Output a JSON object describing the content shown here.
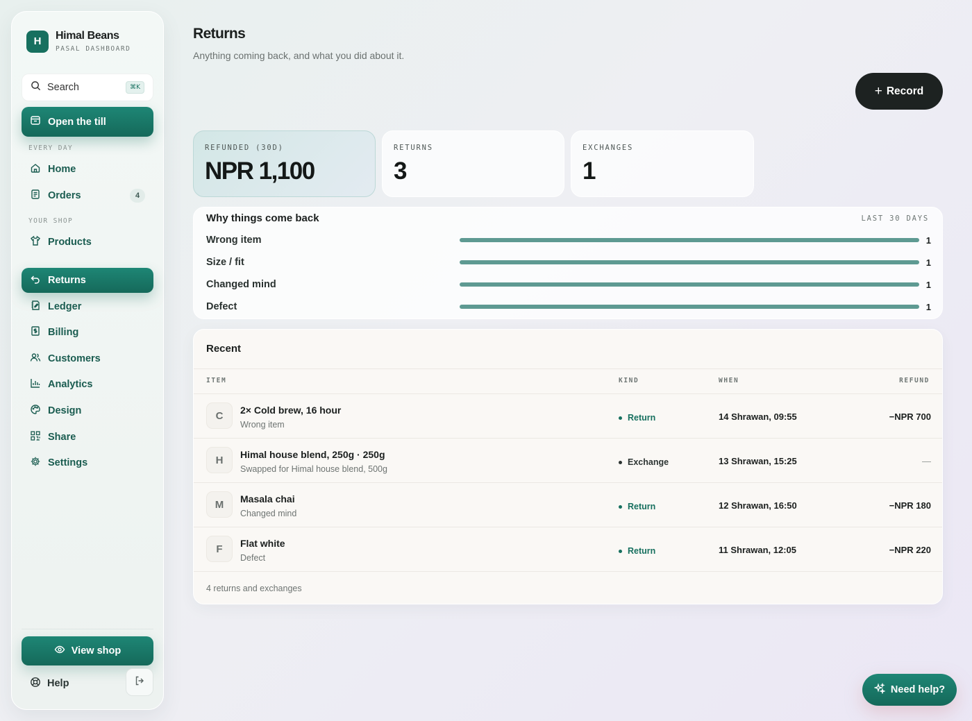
{
  "brand": {
    "initial": "H",
    "name": "Himal Beans",
    "subtitle": "PASAL DASHBOARD"
  },
  "search": {
    "label": "Search",
    "shortcut": "⌘K"
  },
  "till_button": {
    "label": "Open the till"
  },
  "sidebar": {
    "sections": [
      {
        "label": "EVERY DAY"
      },
      {
        "label": "YOUR SHOP"
      }
    ],
    "items": [
      {
        "label": "Home",
        "icon": "home-icon"
      },
      {
        "label": "Orders",
        "icon": "orders-icon",
        "badge": "4"
      },
      {
        "label": "Products",
        "icon": "shirt-icon"
      },
      {
        "label": "Returns",
        "icon": "return-icon",
        "active": true
      },
      {
        "label": "Ledger",
        "icon": "ledger-icon"
      },
      {
        "label": "Billing",
        "icon": "billing-icon"
      },
      {
        "label": "Customers",
        "icon": "users-icon"
      },
      {
        "label": "Analytics",
        "icon": "bar-chart-icon"
      },
      {
        "label": "Design",
        "icon": "palette-icon"
      },
      {
        "label": "Share",
        "icon": "qr-icon"
      },
      {
        "label": "Settings",
        "icon": "gear-icon"
      }
    ],
    "view_shop": "View shop",
    "help": "Help"
  },
  "header": {
    "title": "Returns",
    "subtitle": "Anything coming back, and what you did about it.",
    "record_label": "Record"
  },
  "stats": [
    {
      "label": "REFUNDED (30D)",
      "value": "NPR 1,100"
    },
    {
      "label": "RETURNS",
      "value": "3"
    },
    {
      "label": "EXCHANGES",
      "value": "1"
    }
  ],
  "reasons": {
    "title": "Why things come back",
    "period": "LAST 30 DAYS",
    "rows": [
      {
        "label": "Wrong item",
        "count": "1",
        "fraction": 1.0
      },
      {
        "label": "Size / fit",
        "count": "1",
        "fraction": 1.0
      },
      {
        "label": "Changed mind",
        "count": "1",
        "fraction": 1.0
      },
      {
        "label": "Defect",
        "count": "1",
        "fraction": 1.0
      }
    ]
  },
  "recent": {
    "title": "Recent",
    "columns": {
      "item": "ITEM",
      "kind": "KIND",
      "when": "WHEN",
      "refund": "REFUND"
    },
    "rows": [
      {
        "initial": "C",
        "name": "2× Cold brew, 16 hour",
        "note": "Wrong item",
        "kind": "Return",
        "when": "14 Shrawan, 09:55",
        "refund": "−NPR 700"
      },
      {
        "initial": "H",
        "name": "Himal house blend, 250g · 250g",
        "note": "Swapped for Himal house blend, 500g",
        "kind": "Exchange",
        "when": "13 Shrawan, 15:25",
        "refund": "—"
      },
      {
        "initial": "M",
        "name": "Masala chai",
        "note": "Changed mind",
        "kind": "Return",
        "when": "12 Shrawan, 16:50",
        "refund": "−NPR 180"
      },
      {
        "initial": "F",
        "name": "Flat white",
        "note": "Defect",
        "kind": "Return",
        "when": "11 Shrawan, 12:05",
        "refund": "−NPR 220"
      }
    ],
    "footer": "4 returns and exchanges"
  },
  "need_help": "Need help?",
  "colors": {
    "accent": "#17705f",
    "bar": "#5e9a92",
    "dark_button": "#1d2221"
  }
}
